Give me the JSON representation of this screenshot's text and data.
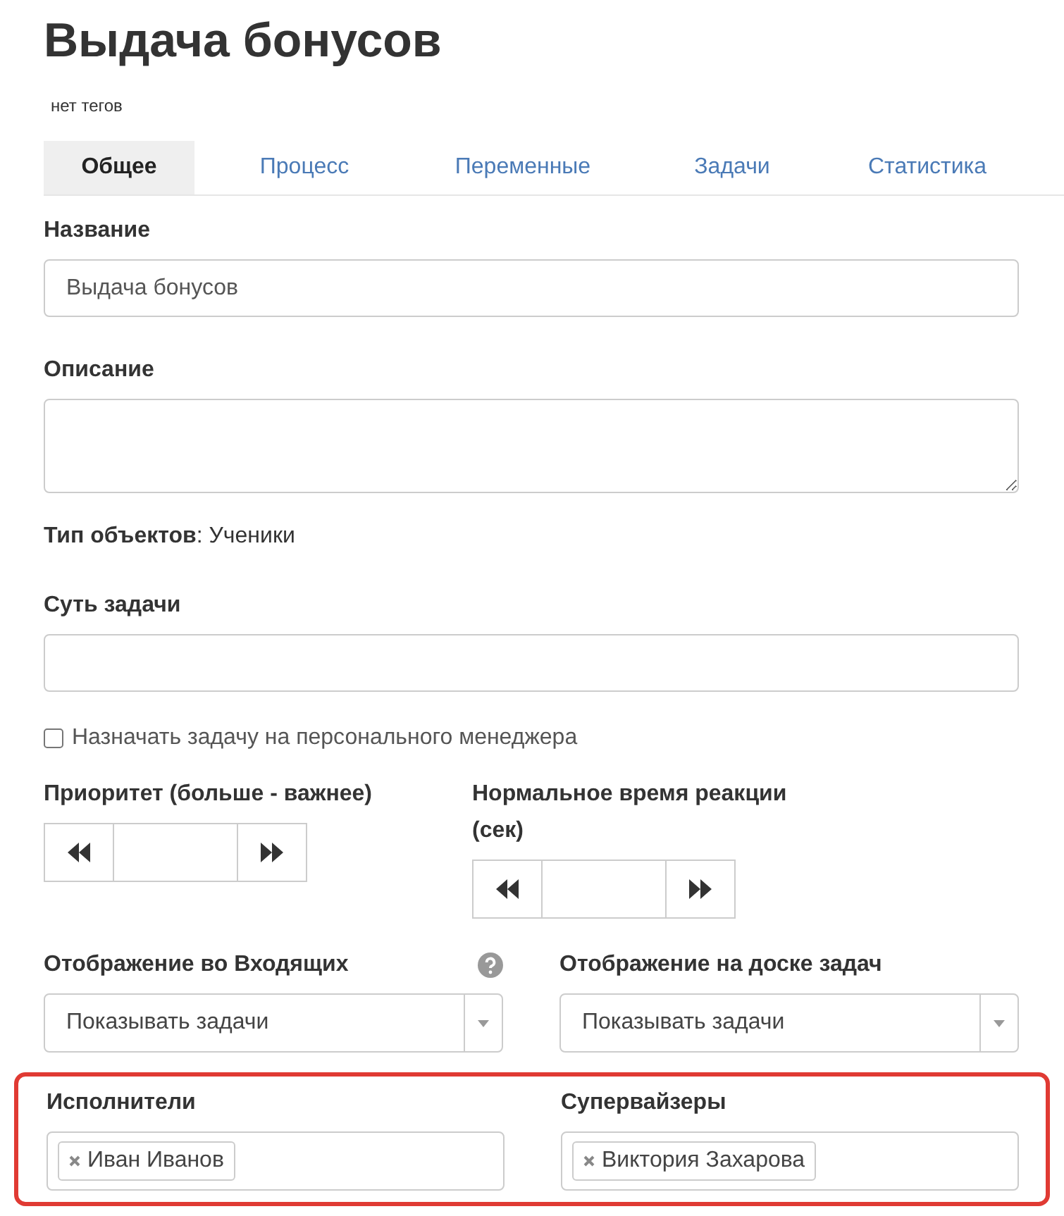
{
  "title": "Выдача бонусов",
  "tags": "нет тегов",
  "tabs": [
    {
      "label": "Общее",
      "selected": true
    },
    {
      "label": "Процесс",
      "selected": false
    },
    {
      "label": "Переменные",
      "selected": false
    },
    {
      "label": "Задачи",
      "selected": false
    },
    {
      "label": "Статистика",
      "selected": false
    }
  ],
  "name_field": {
    "label": "Название",
    "placeholder": "Выдача бонусов"
  },
  "description_field": {
    "label": "Описание"
  },
  "object_type": {
    "label": "Тип объектов",
    "separator": ":",
    "value": "Ученики"
  },
  "task_essence_field": {
    "label": "Суть задачи"
  },
  "personal_manager": {
    "label": "Назначать задачу на персонального менеджера",
    "checked": false
  },
  "steppers": [
    {
      "label": "Приоритет (больше - важнее)"
    },
    {
      "label": "Нормальное время реакции (сек)"
    }
  ],
  "selects": [
    {
      "label": "Отображение во Входящих",
      "value": "Показывать задачи",
      "help": true
    },
    {
      "label": "Отображение на доске задач",
      "value": "Показывать задачи",
      "help": false
    }
  ],
  "people": {
    "highlighted": true,
    "groups": [
      {
        "label": "Исполнители",
        "tags": [
          "Иван Иванов"
        ]
      },
      {
        "label": "Супервайзеры",
        "tags": [
          "Виктория Захарова"
        ]
      }
    ]
  }
}
